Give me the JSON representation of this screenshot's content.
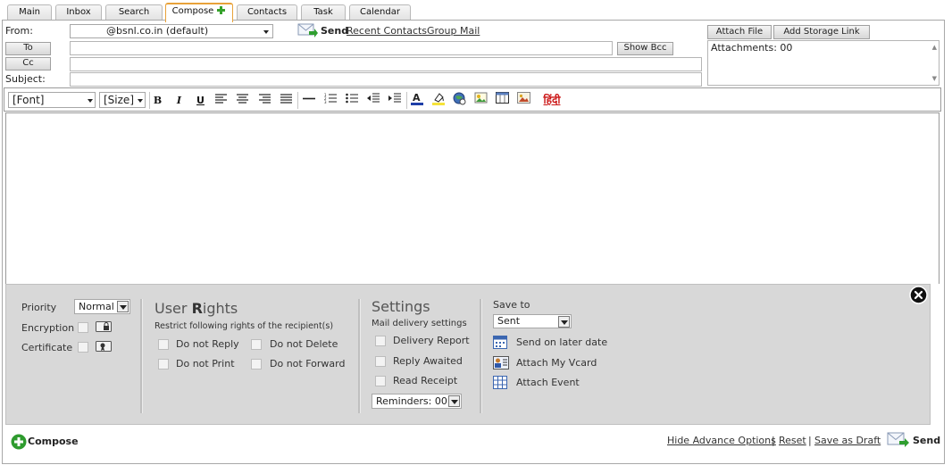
{
  "tabs": [
    {
      "label": "Main"
    },
    {
      "label": "Inbox"
    },
    {
      "label": "Search"
    },
    {
      "label": "Compose",
      "active": true
    },
    {
      "label": "Contacts"
    },
    {
      "label": "Task"
    },
    {
      "label": "Calendar"
    }
  ],
  "header": {
    "from_label": "From:",
    "from_value": "@bsnl.co.in (default)",
    "send_label": "Send",
    "recent_contacts": "Recent Contacts",
    "group_mail": "Group Mail",
    "to_label": "To",
    "cc_label": "Cc",
    "subject_label": "Subject:",
    "show_bcc": "Show Bcc",
    "attach_file": "Attach File",
    "add_storage_link": "Add Storage Link",
    "attachments": "Attachments: 00"
  },
  "toolbar": {
    "font": "[Font]",
    "size": "[Size]",
    "bold": "B",
    "italic": "I",
    "underline": "U",
    "hindi": "हिंदी"
  },
  "options": {
    "priority_label": "Priority",
    "priority_value": "Normal",
    "encryption_label": "Encryption",
    "certificate_label": "Certificate",
    "user_rights_title_a": "User ",
    "user_rights_title_b": "R",
    "user_rights_title_c": "ights",
    "user_rights_sub": "Restrict following rights of the recipient(s)",
    "do_not_reply": "Do not Reply",
    "do_not_delete": "Do not Delete",
    "do_not_print": "Do not Print",
    "do_not_forward": "Do not Forward",
    "settings_title": "Settings",
    "settings_sub": "Mail delivery settings",
    "delivery_report": "Delivery Report",
    "reply_awaited": "Reply Awaited",
    "read_receipt": "Read Receipt",
    "reminders": "Reminders: 00",
    "save_to_label": "Save to",
    "save_to_value": "Sent",
    "send_later": "Send on later date",
    "attach_vcard": "Attach My Vcard",
    "attach_event": "Attach Event"
  },
  "footer": {
    "compose": "Compose",
    "hide_advance": "Hide Advance Options",
    "sep1": "|",
    "reset": "Reset",
    "sep2": "|",
    "save_draft": "Save as Draft",
    "send": "Send"
  },
  "colors": {
    "accent": "#e8a23a",
    "green": "#35a12b",
    "panel": "#d8d8d8"
  }
}
